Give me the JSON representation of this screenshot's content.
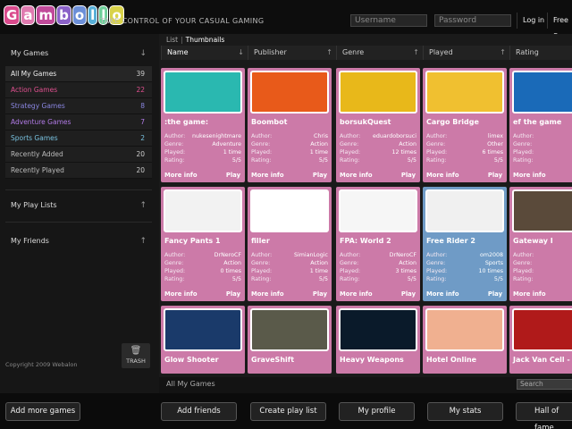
{
  "header": {
    "logo_letters": [
      "G",
      "a",
      "m",
      "b",
      "o",
      "l",
      "l",
      "o"
    ],
    "logo_colors": [
      "#d94a8c",
      "#e07bb0",
      "#c14a9a",
      "#8b62c8",
      "#6c8fd8",
      "#58b0d8",
      "#6fcf9a",
      "#d9d34a"
    ],
    "tagline": "TAKE CONTROL OF YOUR CASUAL GAMING",
    "username_placeholder": "Username",
    "password_placeholder": "Password",
    "login_label": "Log in",
    "free_signup_label": "Free S"
  },
  "sidebar": {
    "my_games_label": "My Games",
    "items": [
      {
        "label": "All My Games",
        "count": "39",
        "color": "#eeeeee"
      },
      {
        "label": "Action Games",
        "count": "22",
        "color": "#e0508f"
      },
      {
        "label": "Strategy Games",
        "count": "8",
        "color": "#8a86e0"
      },
      {
        "label": "Adventure Games",
        "count": "7",
        "color": "#b17ae6"
      },
      {
        "label": "Sports Games",
        "count": "2",
        "color": "#79c2e0"
      },
      {
        "label": "Recently Added",
        "count": "20",
        "color": "#bbbbbb"
      },
      {
        "label": "Recently Played",
        "count": "20",
        "color": "#bbbbbb"
      }
    ],
    "play_lists_label": "My Play Lists",
    "friends_label": "My Friends",
    "copyright": "Copyright 2009 Webalon",
    "trash_label": "TRASH"
  },
  "main": {
    "view_list": "List",
    "view_thumbnails": "Thumbnails",
    "columns": [
      "Name",
      "Publisher",
      "Genre",
      "Played",
      "Rating"
    ],
    "footer_title": "All My Games",
    "search_placeholder": "Search",
    "meta_labels": {
      "author": "Author:",
      "genre": "Genre:",
      "played": "Played:",
      "rating": "Rating:"
    },
    "more_info": "More info",
    "play": "Play",
    "cards": [
      {
        "name": ":the game:",
        "author": "nukesenightmare",
        "genre": "Adventure",
        "played": "1 time",
        "rating": "5/5",
        "color": "pink",
        "thumb": "#2ab8b0"
      },
      {
        "name": "Boombot",
        "author": "Chris",
        "genre": "Action",
        "played": "1 time",
        "rating": "5/5",
        "color": "pink",
        "thumb": "#e85a1a"
      },
      {
        "name": "borsukQuest",
        "author": "eduardoborsuci",
        "genre": "Action",
        "played": "12 times",
        "rating": "5/5",
        "color": "pink",
        "thumb": "#e8b81a"
      },
      {
        "name": "Cargo Bridge",
        "author": "limex",
        "genre": "Other",
        "played": "6 times",
        "rating": "5/5",
        "color": "pink",
        "thumb": "#f0c030"
      },
      {
        "name": "ef the game",
        "author": "",
        "genre": "Adve",
        "played": "",
        "rating": "",
        "color": "pink",
        "thumb": "#1a6ab8"
      },
      {
        "name": "Fancy Pants 1",
        "author": "DrNeroCF",
        "genre": "Action",
        "played": "0 times",
        "rating": "5/5",
        "color": "pink",
        "thumb": "#f2f2f2"
      },
      {
        "name": "filler",
        "author": "SimianLogic",
        "genre": "Action",
        "played": "1 time",
        "rating": "5/5",
        "color": "pink",
        "thumb": "#ffffff"
      },
      {
        "name": "FPA: World 2",
        "author": "DrNeroCF",
        "genre": "Action",
        "played": "3 times",
        "rating": "5/5",
        "color": "pink",
        "thumb": "#f6f6f6"
      },
      {
        "name": "Free Rider 2",
        "author": "om2008",
        "genre": "Sports",
        "played": "10 times",
        "rating": "5/5",
        "color": "blue",
        "thumb": "#f0f0f0"
      },
      {
        "name": "Gateway I",
        "author": "",
        "genre": "Adve",
        "played": "",
        "rating": "",
        "color": "pink",
        "thumb": "#5a4a3a"
      },
      {
        "name": "Glow Shooter",
        "color": "pink",
        "thumb": "#1a3a6a"
      },
      {
        "name": "GraveShift",
        "color": "pink",
        "thumb": "#5a5a4a"
      },
      {
        "name": "Heavy Weapons",
        "color": "pink",
        "thumb": "#0a1a2a"
      },
      {
        "name": "Hotel Online",
        "color": "pink",
        "thumb": "#f0b090"
      },
      {
        "name": "Jack Van Cell -",
        "color": "pink",
        "thumb": "#b01a1a"
      }
    ]
  },
  "bottom": {
    "add_more_games": "Add more games",
    "add_friends": "Add friends",
    "create_play_list": "Create play list",
    "my_profile": "My profile",
    "my_stats": "My stats",
    "hall_of_fame": "Hall of fame"
  }
}
